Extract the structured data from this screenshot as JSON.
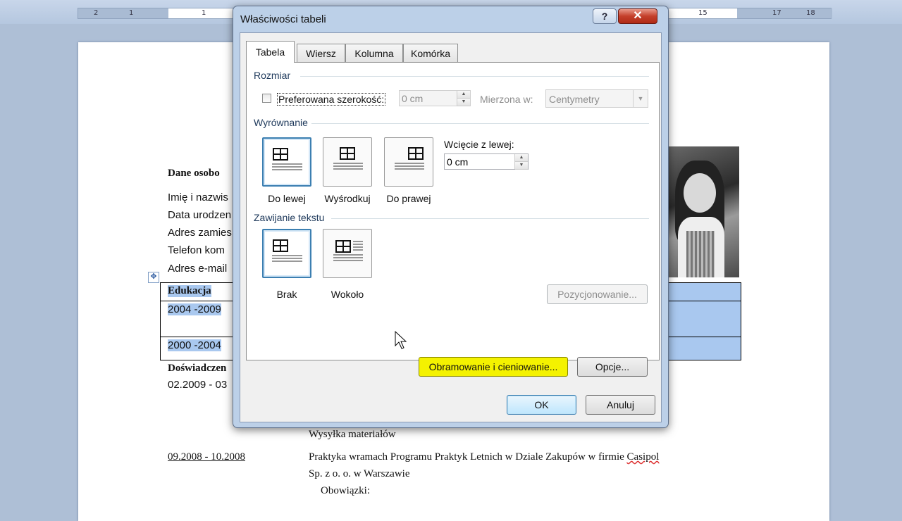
{
  "ruler": {
    "left_ticks": [
      "2",
      "1",
      "1"
    ],
    "right_ticks": [
      "15",
      "17",
      "18"
    ]
  },
  "document": {
    "section_personal": "Dane osobo",
    "lines": [
      "Imię i nazwis",
      "Data urodzen",
      "Adres zamies",
      "Telefon kom",
      "Adres e-mail"
    ],
    "section_education": "Edukacja",
    "edu_rows": [
      "2004 -2009",
      "2000 -2004"
    ],
    "section_experience": "Doświadczen",
    "exp_date_1": "02.2009 - 03",
    "shipping": "Wysyłka materiałów",
    "exp_date_2": "09.2008 - 10.2008",
    "internship_line1_a": "Praktyka wramach Programu Praktyk Letnich w Dziale Zakupów w firmie ",
    "internship_line1_b": "Casipol",
    "internship_line2": "Sp. z o. o. w Warszawie",
    "duties": "Obowiązki:",
    "move_handle": "✥"
  },
  "dialog": {
    "title": "Właściwości tabeli",
    "help_label": "?",
    "close_label": "✕",
    "tabs": [
      {
        "label": "Tabela",
        "active": true
      },
      {
        "label": "Wiersz",
        "active": false
      },
      {
        "label": "Kolumna",
        "active": false
      },
      {
        "label": "Komórka",
        "active": false
      }
    ],
    "size_section": "Rozmiar",
    "preferred_width_label": "Preferowana szerokość:",
    "preferred_width_value": "0 cm",
    "measured_in_label": "Mierzona w:",
    "measured_in_value": "Centymetry",
    "alignment_section": "Wyrównanie",
    "align_left": "Do lewej",
    "align_center": "Wyśrodkuj",
    "align_right": "Do prawej",
    "indent_label": "Wcięcie z lewej:",
    "indent_value": "0 cm",
    "wrap_section": "Zawijanie tekstu",
    "wrap_none": "Brak",
    "wrap_around": "Wokoło",
    "positioning_button": "Pozycjonowanie...",
    "borders_button": "Obramowanie i cieniowanie...",
    "options_button": "Opcje...",
    "ok_button": "OK",
    "cancel_button": "Anuluj"
  },
  "colors": {
    "highlight": "#f4f200",
    "selection": "#a9c8ef",
    "accent": "#3c7fb1"
  }
}
